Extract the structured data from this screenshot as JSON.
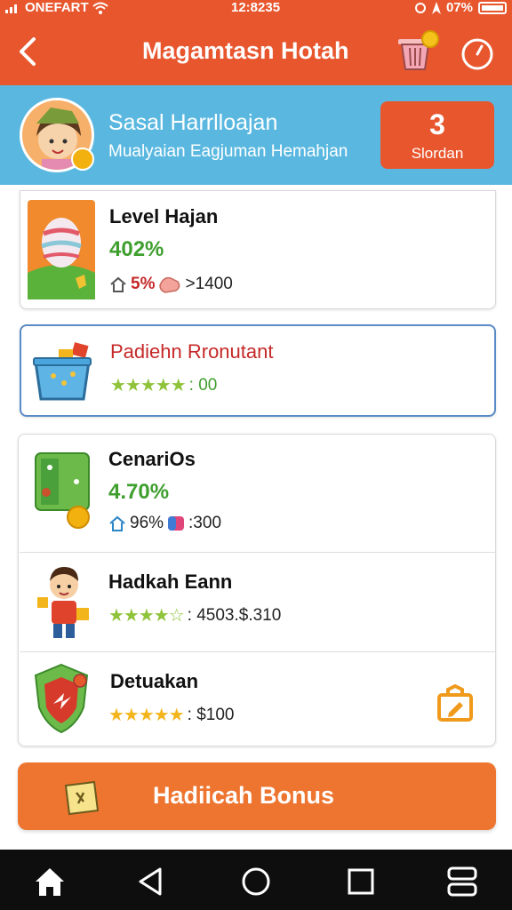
{
  "status_bar": {
    "carrier": "ONEFART",
    "time": "12:8235",
    "battery": "07%"
  },
  "header": {
    "title": "Magamtasn Hotah"
  },
  "profile": {
    "name": "Sasal Harrlloajan",
    "subtitle": "Mualyaian Eagjuman Hemahjan",
    "count": "3",
    "count_label": "Slordan"
  },
  "cards": [
    {
      "title": "Level Hajan",
      "percent": "402%",
      "meta_a": "5%",
      "meta_b": ">1400"
    },
    {
      "title": "Padiehn Rronutant",
      "rating_text": ": 00"
    },
    {
      "title": "CenariOs",
      "percent": "4.70%",
      "meta_a": "96%",
      "meta_b": ":300"
    },
    {
      "title": "Hadkah Eann",
      "rating_text": ": 4503.$.310"
    },
    {
      "title": "Detuakan",
      "rating_text": ": $100"
    }
  ],
  "bonus_button": {
    "label": "Hadiicah Bonus"
  },
  "colors": {
    "header": "#e8562e",
    "profile_strip": "#5ab8e0",
    "percent_green": "#3f9f2e",
    "bonus_orange": "#ee7530",
    "accent_red": "#c62828"
  },
  "icons": {
    "back": "back-arrow-icon",
    "cart": "shopping-basket-icon",
    "timer": "timer-icon",
    "home": "home-icon",
    "nav_back": "triangle-back-icon",
    "nav_home": "circle-home-icon",
    "nav_recent": "square-recent-icon",
    "nav_menu": "menu-icon"
  }
}
